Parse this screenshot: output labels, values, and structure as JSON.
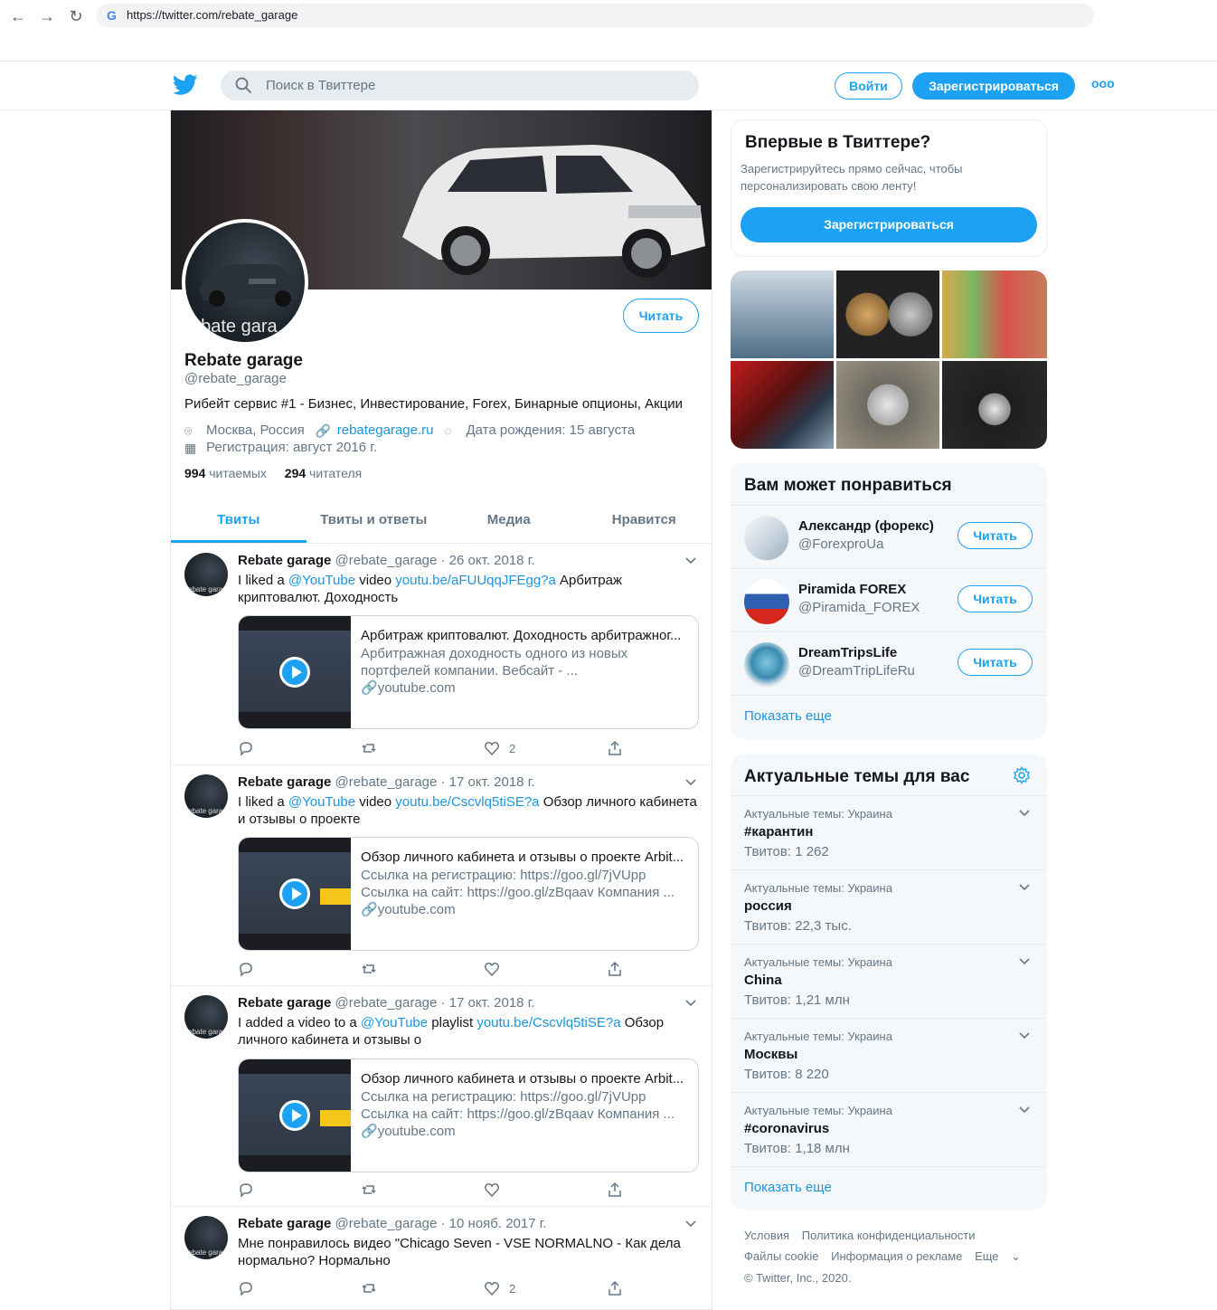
{
  "browser": {
    "url": "https://twitter.com/rebate_garage"
  },
  "header": {
    "search_placeholder": "Поиск в Твиттере",
    "login_label": "Войти",
    "signup_label": "Зарегистрироваться",
    "more_label": "ooo"
  },
  "profile": {
    "avatar_text": "ebate gara",
    "follow_label": "Читать",
    "name": "Rebate garage",
    "handle": "@rebate_garage",
    "bio": "Рибейт сервис #1 - Бизнес, Инвестирование, Forex, Бинарные опционы, Акции",
    "location": "Москва, Россия",
    "website": "rebategarage.ru",
    "birthday": "Дата рождения: 15 августа",
    "joined": "Регистрация: август 2016 г.",
    "following_count": "994",
    "following_label": "читаемых",
    "followers_count": "294",
    "followers_label": "читателя"
  },
  "tabs": [
    "Твиты",
    "Твиты и ответы",
    "Медиа",
    "Нравится"
  ],
  "tweets": [
    {
      "name": "Rebate garage",
      "meta": "@rebate_garage · 26 окт. 2018 г.",
      "text_pre": "I liked a ",
      "mention": "@YouTube",
      "text_mid": " video ",
      "link": "youtu.be/aFUUqqJFEgg?a",
      "text_post": " Арбитраж криптовалют. Доходность",
      "card_title": "Арбитраж криптовалют. Доходность арбитражног...",
      "card_desc1": "Арбитражная доходность одного из новых",
      "card_desc2": "портфелей компании. Вебсайт - ...",
      "card_domain": "youtube.com",
      "likes": "2"
    },
    {
      "name": "Rebate garage",
      "meta": "@rebate_garage · 17 окт. 2018 г.",
      "text_pre": "I liked a ",
      "mention": "@YouTube",
      "text_mid": " video ",
      "link": "youtu.be/Cscvlq5tiSE?a",
      "text_post": " Обзор личного кабинета и отзывы о проекте",
      "card_title": "Обзор личного кабинета и отзывы о проекте Arbit...",
      "card_desc1": "Ссылка на регистрацию: https://goo.gl/7jVUpp",
      "card_desc2": "Ссылка на сайт: https://goo.gl/zBqaav Компания ...",
      "card_domain": "youtube.com",
      "likes": ""
    },
    {
      "name": "Rebate garage",
      "meta": "@rebate_garage · 17 окт. 2018 г.",
      "text_pre": "I added a video to a ",
      "mention": "@YouTube",
      "text_mid": " playlist ",
      "link": "youtu.be/Cscvlq5tiSE?a",
      "text_post": " Обзор личного кабинета и отзывы о",
      "card_title": "Обзор личного кабинета и отзывы о проекте Arbit...",
      "card_desc1": "Ссылка на регистрацию: https://goo.gl/7jVUpp",
      "card_desc2": "Ссылка на сайт: https://goo.gl/zBqaav Компания ...",
      "card_domain": "youtube.com",
      "likes": ""
    },
    {
      "name": "Rebate garage",
      "meta": "@rebate_garage · 10 нояб. 2017 г.",
      "text": "Мне понравилось видео \"Chicago Seven - VSE NORMALNO - Как дела нормально? Нормально",
      "likes": "2"
    }
  ],
  "signup_box": {
    "title": "Впервые в Твиттере?",
    "desc": "Зарегистрируйтесь прямо сейчас, чтобы персонализировать свою ленту!",
    "button": "Зарегистрироваться"
  },
  "suggestions": {
    "title": "Вам может понравиться",
    "items": [
      {
        "name": "Александр (форекс)",
        "handle": "@ForexproUa",
        "button": "Читать"
      },
      {
        "name": "Piramida FOREX",
        "handle": "@Piramida_FOREX",
        "button": "Читать"
      },
      {
        "name": "DreamTripsLife",
        "handle": "@DreamTripLifeRu",
        "button": "Читать"
      }
    ],
    "show_more": "Показать еще"
  },
  "trends": {
    "title": "Актуальные темы для вас",
    "items": [
      {
        "context": "Актуальные темы: Украина",
        "name": "#карантин",
        "count": "Твитов: 1 262"
      },
      {
        "context": "Актуальные темы: Украина",
        "name": "россия",
        "count": "Твитов: 22,3 тыс."
      },
      {
        "context": "Актуальные темы: Украина",
        "name": "China",
        "count": "Твитов: 1,21 млн"
      },
      {
        "context": "Актуальные темы: Украина",
        "name": "Москвы",
        "count": "Твитов: 8 220"
      },
      {
        "context": "Актуальные темы: Украина",
        "name": "#coronavirus",
        "count": "Твитов: 1,18 млн"
      }
    ],
    "show_more": "Показать еще"
  },
  "footer": {
    "terms": "Условия",
    "privacy": "Политика конфиденциальности",
    "cookies": "Файлы cookie",
    "ads": "Информация о рекламе",
    "more": "Еще",
    "copyright": "© Twitter, Inc., 2020."
  },
  "colors": {
    "accent": "#1da1f2",
    "link": "#1b95e0",
    "muted": "#657786"
  }
}
